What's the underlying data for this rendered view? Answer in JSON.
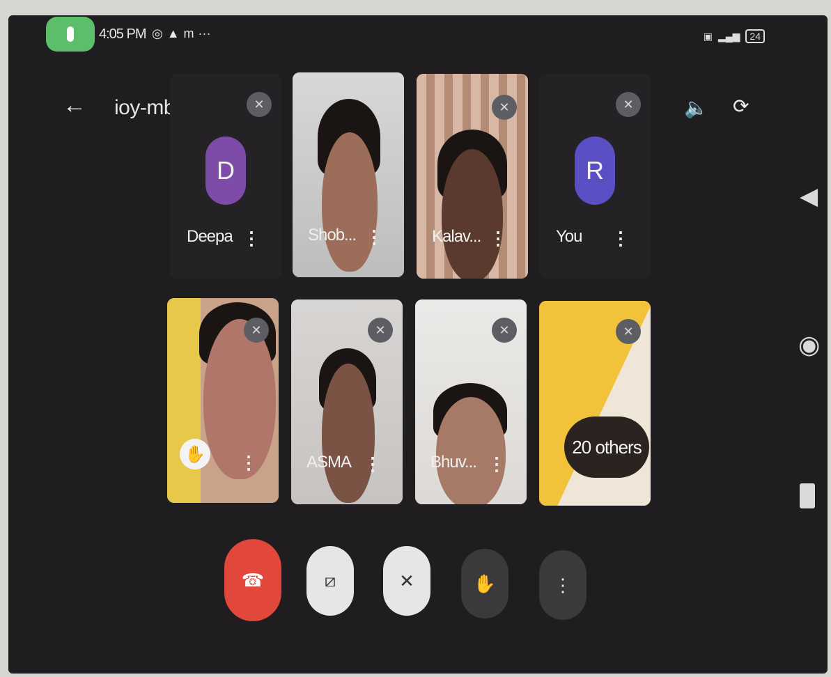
{
  "status": {
    "time": "4:05 PM",
    "icons": [
      "whatsapp-icon",
      "drive-icon",
      "m-icon",
      "more-dots"
    ],
    "battery": "24"
  },
  "header": {
    "back_label": "←",
    "meeting_code": "ioy-mbzy-djz",
    "chevron": "▸"
  },
  "tiles": [
    {
      "name": "Deepa",
      "initial": "D",
      "type": "avatar",
      "muted": true
    },
    {
      "name": "Shob...",
      "type": "video",
      "muted": false
    },
    {
      "name": "Kalav...",
      "type": "video",
      "muted": true
    },
    {
      "name": "You",
      "initial": "R",
      "type": "avatar",
      "muted": true
    },
    {
      "name": "",
      "type": "video",
      "muted": true,
      "hand_raised": true
    },
    {
      "name": "ASMA",
      "type": "video",
      "muted": true
    },
    {
      "name": "Bhuv...",
      "type": "video",
      "muted": true
    },
    {
      "name": "20 others",
      "type": "others",
      "muted": true
    }
  ],
  "controls": [
    "end-call",
    "camera-off",
    "mic-off",
    "raise-hand",
    "more-options"
  ],
  "glyphs": {
    "menu": "⋮",
    "mute": "🎙̸",
    "hand": "✋",
    "end": "☎",
    "cam": "▭",
    "speaker": "🔊",
    "flip": "⟳"
  },
  "colors": {
    "end_call": "#e1473a",
    "avatar_deepa": "#7d4ba8",
    "avatar_you": "#5b4fc5"
  }
}
